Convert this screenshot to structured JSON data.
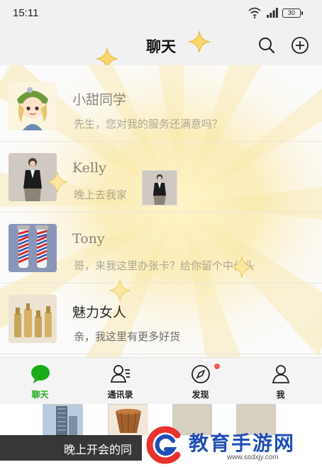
{
  "status_bar": {
    "time": "15:11",
    "battery": "30"
  },
  "header": {
    "title": "聊天"
  },
  "chats": [
    {
      "name": "小甜同学",
      "message": "先生，您对我的服务还满意吗？"
    },
    {
      "name": "Kelly",
      "message": "晚上去我家"
    },
    {
      "name": "Tony",
      "message": "哥，来我这里办张卡？给你留个中分头"
    },
    {
      "name": "魅力女人",
      "message": "亲，我这里有更多好货"
    }
  ],
  "tabs": [
    {
      "label": "聊天",
      "icon": "chat-bubble-icon",
      "active": true
    },
    {
      "label": "通讯录",
      "icon": "contacts-icon",
      "active": false
    },
    {
      "label": "发现",
      "icon": "compass-icon",
      "active": false
    },
    {
      "label": "我",
      "icon": "person-icon",
      "active": false
    }
  ],
  "bottom_strip": {
    "subtitle": "晚上开会的同"
  },
  "watermark": {
    "text": "教育手游网",
    "url": "www.ssdxjy.com"
  },
  "colors": {
    "accent": "#1aad19",
    "badge": "#f25c54",
    "watermark": "#1f4fb5"
  }
}
